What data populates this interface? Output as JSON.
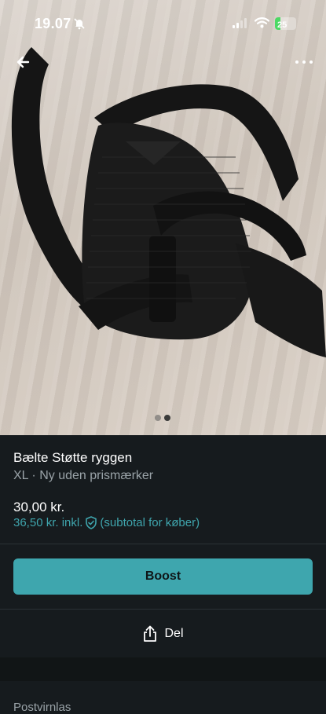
{
  "status_bar": {
    "time": "19.07",
    "battery": "25",
    "battery_level": 0.25
  },
  "header": {
    "back_icon": "arrow-left-icon",
    "more_icon": "more-horizontal-icon"
  },
  "gallery": {
    "total_images": 2,
    "current_index": 2
  },
  "listing": {
    "title": "Bælte Støtte ryggen",
    "subtitle": "XL · Ny uden prismærker",
    "price": "30,00 kr.",
    "total_price": "36,50 kr. inkl.",
    "total_suffix": "(subtotal for køber)"
  },
  "actions": {
    "boost_label": "Boost",
    "share_label": "Del"
  },
  "next_section": {
    "label": "Postvirnlas"
  },
  "colors": {
    "accent": "#3ea6ae",
    "background": "#161b1e",
    "muted_text": "#9aa3a8"
  }
}
